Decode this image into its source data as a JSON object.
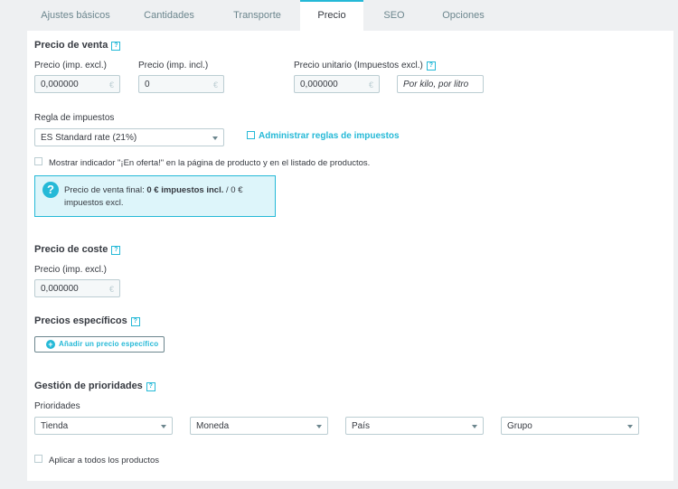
{
  "tabs": [
    {
      "label": "Ajustes básicos",
      "active": false
    },
    {
      "label": "Cantidades",
      "active": false
    },
    {
      "label": "Transporte",
      "active": false
    },
    {
      "label": "Precio",
      "active": true
    },
    {
      "label": "SEO",
      "active": false
    },
    {
      "label": "Opciones",
      "active": false
    }
  ],
  "help_glyph": "?",
  "sale_price": {
    "title": "Precio de venta",
    "tax_excl": {
      "label": "Precio (imp. excl.)",
      "value": "0,000000",
      "currency": "€"
    },
    "tax_incl": {
      "label": "Precio (imp. incl.)",
      "value": "0",
      "currency": "€"
    },
    "unit_price": {
      "label": "Precio unitario (Impuestos excl.)",
      "value": "0,000000",
      "currency": "€",
      "unit_placeholder": "Por kilo, por litro"
    }
  },
  "tax_rule": {
    "label": "Regla de impuestos",
    "selected": "ES Standard rate (21%)",
    "manage_link": "Administrar reglas de impuestos"
  },
  "on_sale": {
    "label": "Mostrar indicador \"¡En oferta!\" en la página de producto y en el listado de productos.",
    "checked": false
  },
  "final_price": {
    "prefix": "Precio de venta final: ",
    "incl": "0 € impuestos incl.",
    "suffix": " / 0 € impuestos excl."
  },
  "cost_price": {
    "title": "Precio de coste",
    "label": "Precio (imp. excl.)",
    "value": "0,000000",
    "currency": "€"
  },
  "specific_prices": {
    "title": "Precios específicos",
    "add_button": "Añadir un precio específico"
  },
  "priorities": {
    "title": "Gestión de prioridades",
    "label": "Prioridades",
    "selects": [
      "Tienda",
      "Moneda",
      "País",
      "Grupo"
    ],
    "apply_all": {
      "label": "Aplicar a todos los productos",
      "checked": false
    }
  },
  "colors": {
    "accent": "#25b9d7",
    "border": "#bbcdd2",
    "info_bg": "#ddf5fa"
  }
}
